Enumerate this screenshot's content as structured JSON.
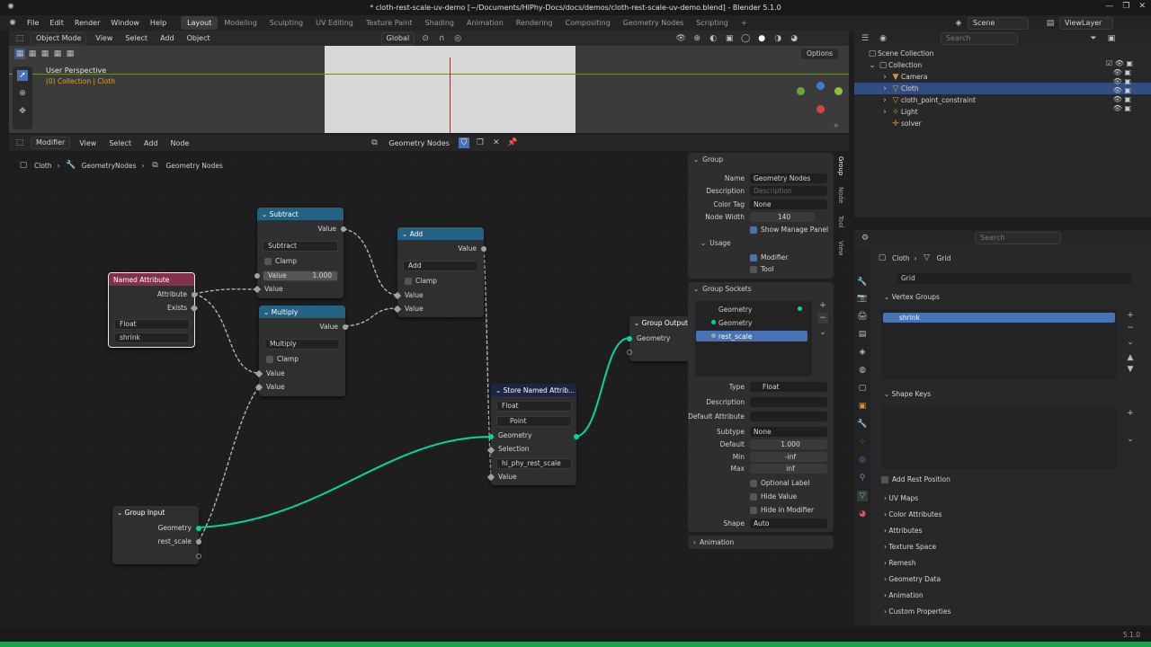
{
  "window": {
    "title": "* cloth-rest-scale-uv-demo [~/Documents/HIPhy-Docs/docs/demos/cloth-rest-scale-uv-demo.blend] - Blender 5.1.0"
  },
  "menu": [
    "File",
    "Edit",
    "Render",
    "Window",
    "Help"
  ],
  "workspaces": [
    "Layout",
    "Modeling",
    "Sculpting",
    "UV Editing",
    "Texture Paint",
    "Shading",
    "Animation",
    "Rendering",
    "Compositing",
    "Geometry Nodes",
    "Scripting"
  ],
  "scene": {
    "scene_name": "Scene",
    "view_layer": "ViewLayer"
  },
  "viewport": {
    "mode": "Object Mode",
    "view": "View",
    "select": "Select",
    "add": "Add",
    "object": "Object",
    "orientation": "Global",
    "perspective": "User Perspective",
    "collection_info": "(0) Collection | Cloth",
    "options": "Options"
  },
  "node_editor": {
    "type": "Modifier",
    "view": "View",
    "select": "Select",
    "add": "Add",
    "node": "Node",
    "tree_name": "Geometry Nodes",
    "breadcrumb": [
      "Cloth",
      "GeometryNodes",
      "Geometry Nodes"
    ]
  },
  "nodes": {
    "named_attribute": {
      "title": "Named Attribute",
      "out_attribute": "Attribute",
      "out_exists": "Exists",
      "type": "Float",
      "name": "shrink"
    },
    "subtract": {
      "title": "Subtract",
      "out": "Value",
      "op": "Subtract",
      "clamp": "Clamp",
      "in_value_label": "Value",
      "in_value": "1.000",
      "in2": "Value"
    },
    "multiply": {
      "title": "Multiply",
      "out": "Value",
      "op": "Multiply",
      "clamp": "Clamp",
      "in1": "Value",
      "in2": "Value"
    },
    "add": {
      "title": "Add",
      "out": "Value",
      "op": "Add",
      "clamp": "Clamp",
      "in1": "Value",
      "in2": "Value"
    },
    "store": {
      "title": "Store Named Attrib...",
      "type": "Float",
      "domain": "Point",
      "in_geometry": "Geometry",
      "in_selection": "Selection",
      "name": "hi_phy_rest_scale",
      "in_value": "Value"
    },
    "group_output": {
      "title": "Group Output",
      "in_geometry": "Geometry"
    },
    "group_input": {
      "title": "Group Input",
      "out_geometry": "Geometry",
      "out_rest_scale": "rest_scale"
    }
  },
  "npanel": {
    "group_title": "Group",
    "name_label": "Name",
    "name": "Geometry Nodes",
    "desc_label": "Description",
    "desc_placeholder": "Description",
    "color_tag_label": "Color Tag",
    "color_tag": "None",
    "node_width_label": "Node Width",
    "node_width": "140",
    "show_manage": "Show Manage Panel",
    "usage": "Usage",
    "modifier": "Modifier",
    "tool": "Tool",
    "sockets_title": "Group Sockets",
    "sockets": [
      "Geometry",
      "Geometry",
      "rest_scale"
    ],
    "type_label": "Type",
    "type": "Float",
    "description_label": "Description",
    "default_attr_label": "Default Attribute",
    "subtype_label": "Subtype",
    "subtype": "None",
    "default_label": "Default",
    "default": "1.000",
    "min_label": "Min",
    "min": "-inf",
    "max_label": "Max",
    "max": "inf",
    "optional_label": "Optional Label",
    "hide_value": "Hide Value",
    "hide_in_modifier": "Hide in Modifier",
    "shape_label": "Shape",
    "shape": "Auto",
    "animation": "Animation",
    "tabs": [
      "Group",
      "Node",
      "Tool",
      "View"
    ]
  },
  "outliner": {
    "search_placeholder": "Search",
    "items": [
      "Scene Collection",
      "Collection",
      "Camera",
      "Cloth",
      "cloth_point_constraint",
      "Light",
      "solver"
    ]
  },
  "properties": {
    "search_placeholder": "Search",
    "breadcrumb_obj": "Cloth",
    "breadcrumb_data": "Grid",
    "data_name": "Grid",
    "vertex_groups": "Vertex Groups",
    "vg_item": "shrink",
    "shape_keys": "Shape Keys",
    "add_rest": "Add Rest Position",
    "sections": [
      "UV Maps",
      "Color Attributes",
      "Attributes",
      "Texture Space",
      "Remesh",
      "Geometry Data",
      "Animation",
      "Custom Properties"
    ]
  },
  "status": {
    "version": "5.1.0"
  },
  "colors": {
    "accent": "#4772b3",
    "geometry_socket": "#00d6a3",
    "math_header": "#246283",
    "attr_header": "#83314a",
    "store_header": "#1d2546",
    "group_header": "#2f2f2f"
  }
}
